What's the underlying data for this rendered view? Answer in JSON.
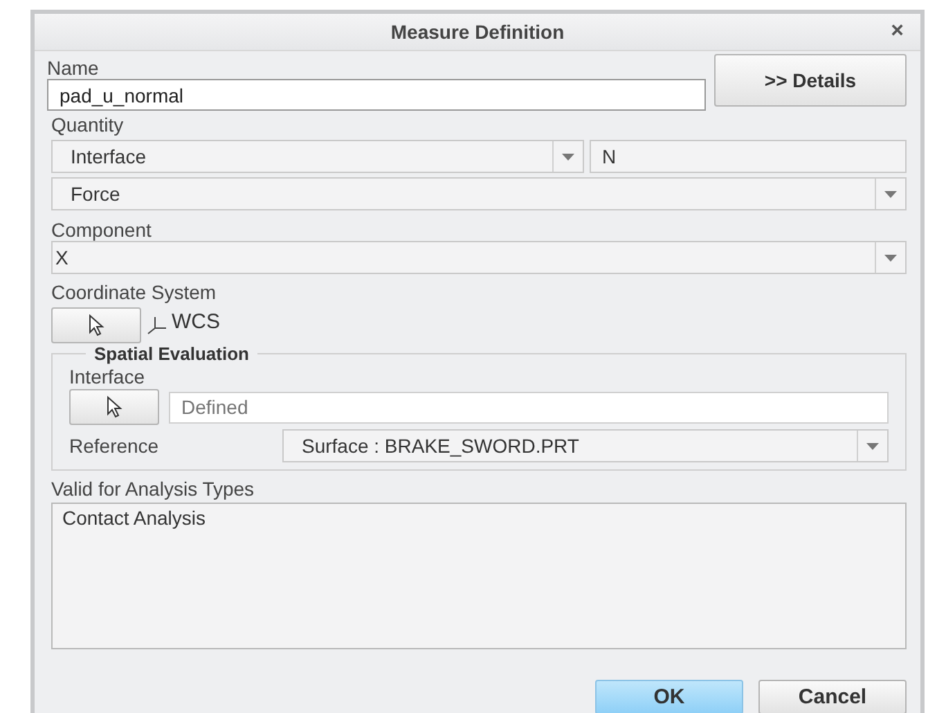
{
  "window": {
    "title": "Measure Definition",
    "close": "×"
  },
  "name": {
    "label": "Name",
    "value": "pad_u_normal"
  },
  "details_button": ">> Details",
  "quantity": {
    "label": "Quantity",
    "type": "Interface",
    "unit": "N",
    "measure": "Force"
  },
  "component": {
    "label": "Component",
    "value": "X"
  },
  "coordinate_system": {
    "label": "Coordinate System",
    "value": "WCS"
  },
  "spatial_evaluation": {
    "title": "Spatial Evaluation",
    "interface_label": "Interface",
    "interface_placeholder": "Defined",
    "reference_label": "Reference",
    "reference": "Surface : BRAKE_SWORD.PRT"
  },
  "analysis_types": {
    "label": "Valid for Analysis Types",
    "items": [
      "Contact Analysis"
    ]
  },
  "buttons": [
    {
      "label": "OK",
      "kind": "primary"
    },
    {
      "label": "Cancel",
      "kind": "normal"
    }
  ]
}
